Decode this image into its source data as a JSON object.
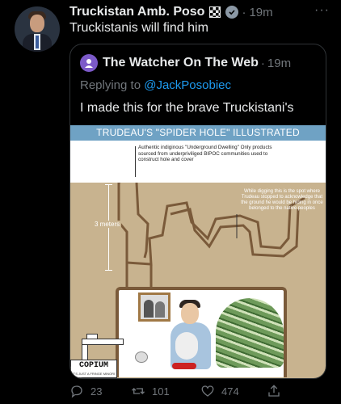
{
  "tweet": {
    "author_name": "Truckistan Amb. Poso",
    "time": "19m",
    "text": "Truckistanis will find him",
    "more": "···"
  },
  "quote": {
    "author_name": "The Watcher On The Web",
    "time": "19m",
    "reply_prefix": "Replying to",
    "reply_handle": "@JackPosobiec",
    "text": "I made this for the brave Truckistani's"
  },
  "illustration": {
    "title": "TRUDEAU'S \"SPIDER HOLE\" ILLUSTRATED",
    "callout": "Authentic indiginous \"Underground Dwelling\" Only products sourced from underpriviliged BIPOC communities used to construct hole and cover",
    "note": "While digging this is the spot where Trudeau stopped to acknowledge that the ground he would be hiding in once belonged to the native peoples",
    "meters": "3 meters",
    "copium": "COPIUM",
    "copium_sub": "IT'S JUST A FRINGE MINORITY"
  },
  "actions": {
    "replies": "23",
    "retweets": "101",
    "likes": "474"
  }
}
